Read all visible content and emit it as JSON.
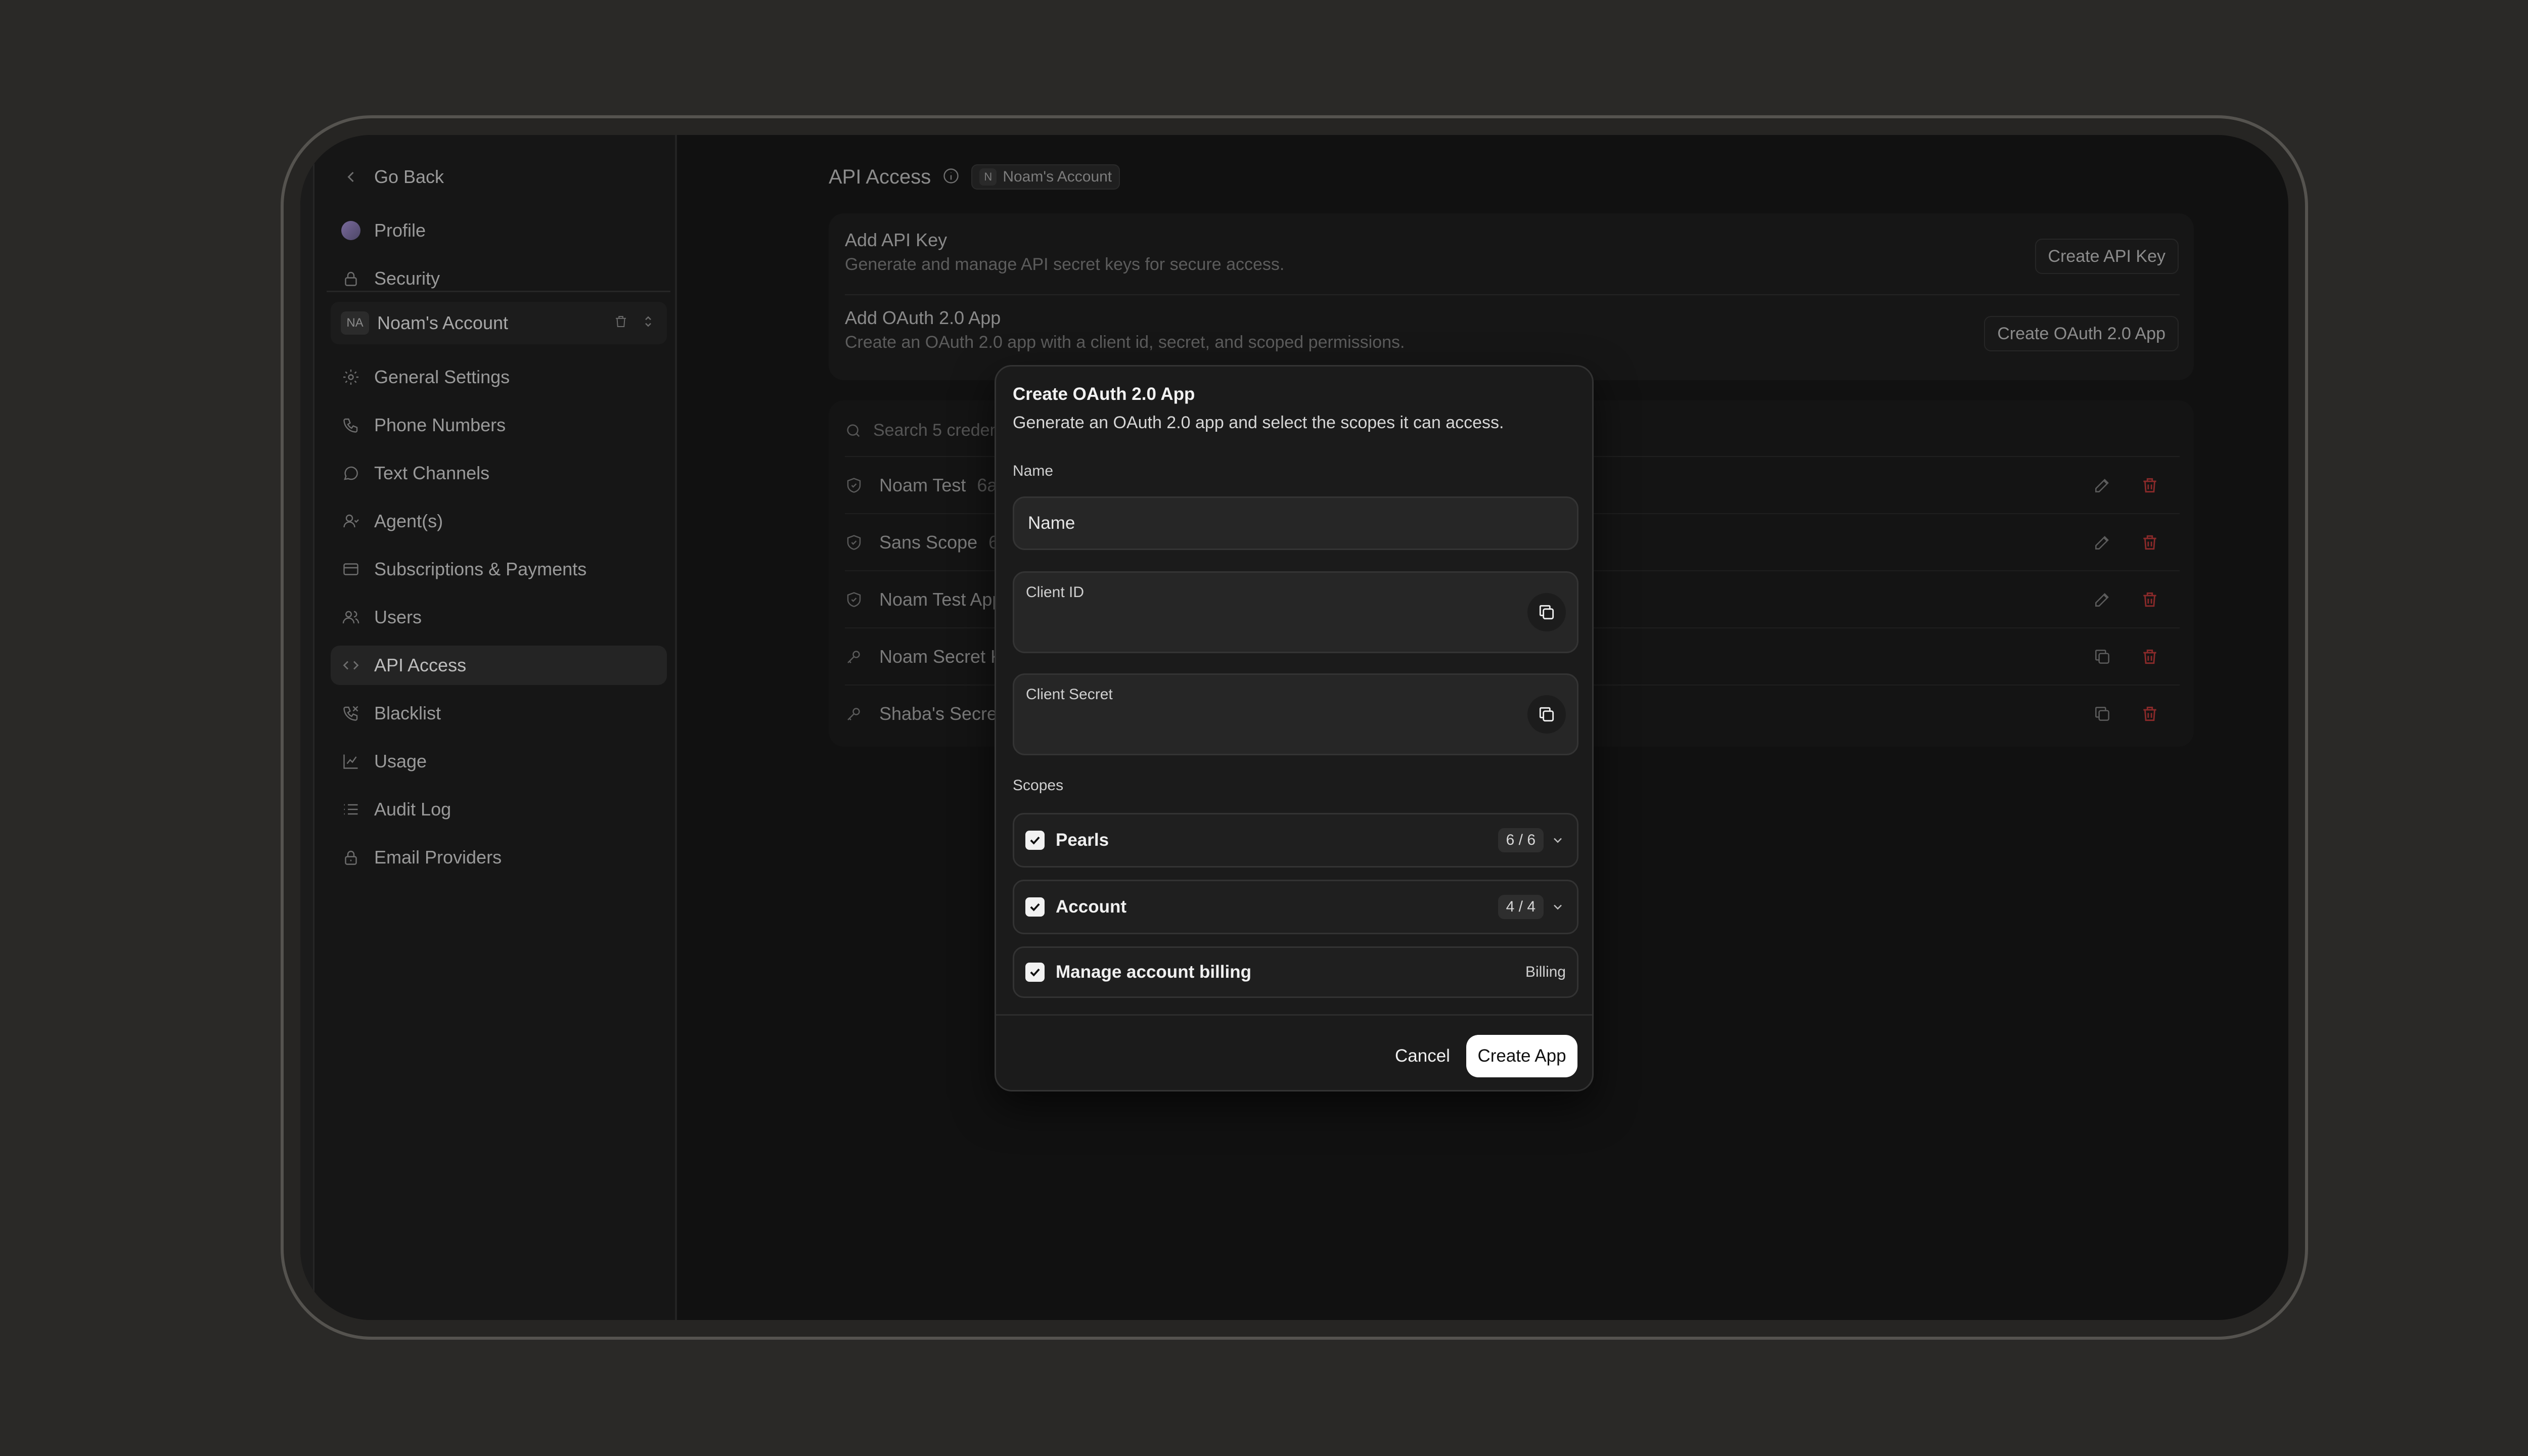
{
  "sidebar": {
    "go_back": "Go Back",
    "profile": "Profile",
    "security": "Security",
    "account_badge": "NA",
    "account_name": "Noam's Account",
    "items": [
      {
        "label": "General Settings",
        "icon": "gear-icon"
      },
      {
        "label": "Phone Numbers",
        "icon": "phone-icon"
      },
      {
        "label": "Text Channels",
        "icon": "chat-icon"
      },
      {
        "label": "Agent(s)",
        "icon": "agent-icon"
      },
      {
        "label": "Subscriptions & Payments",
        "icon": "card-icon"
      },
      {
        "label": "Users",
        "icon": "users-icon"
      },
      {
        "label": "API Access",
        "icon": "code-icon"
      },
      {
        "label": "Blacklist",
        "icon": "phone-block-icon"
      },
      {
        "label": "Usage",
        "icon": "chart-icon"
      },
      {
        "label": "Audit Log",
        "icon": "list-icon"
      },
      {
        "label": "Email Providers",
        "icon": "lock-icon"
      }
    ]
  },
  "main": {
    "title": "API Access",
    "account_chip_letter": "N",
    "account_chip": "Noam's Account",
    "api_key": {
      "title": "Add API Key",
      "subtitle": "Generate and manage API secret keys for secure access.",
      "button": "Create API Key"
    },
    "oauth": {
      "title": "Add OAuth 2.0 App",
      "subtitle": "Create an OAuth 2.0 app with a client id, secret, and scoped permissions.",
      "button": "Create OAuth 2.0 App"
    },
    "search_placeholder": "Search 5 credent",
    "credentials": [
      {
        "name": "Noam Test",
        "id": "6a7",
        "type": "oauth"
      },
      {
        "name": "Sans Scope",
        "id": "6a6",
        "type": "oauth"
      },
      {
        "name": "Noam Test App",
        "id": "",
        "type": "oauth"
      },
      {
        "name": "Noam Secret Ke",
        "id": "",
        "type": "key"
      },
      {
        "name": "Shaba's Secret",
        "id": "",
        "type": "key"
      }
    ]
  },
  "modal": {
    "title": "Create OAuth 2.0 App",
    "subtitle": "Generate an OAuth 2.0 app and select the scopes it can access.",
    "name_label": "Name",
    "name_placeholder": "Name",
    "client_id_label": "Client ID",
    "client_secret_label": "Client Secret",
    "scopes_label": "Scopes",
    "scopes": [
      {
        "name": "Pearls",
        "count": "6 / 6",
        "checked": true
      },
      {
        "name": "Account",
        "count": "4 / 4",
        "checked": true
      },
      {
        "name": "Manage account billing",
        "tag": "Billing",
        "checked": true
      }
    ],
    "cancel": "Cancel",
    "create": "Create App"
  },
  "colors": {
    "background": "#2a2927",
    "screen": "#111111",
    "modal": "#1b1b1b",
    "primary_button": "#ffffff",
    "danger": "#8a2a2a"
  }
}
